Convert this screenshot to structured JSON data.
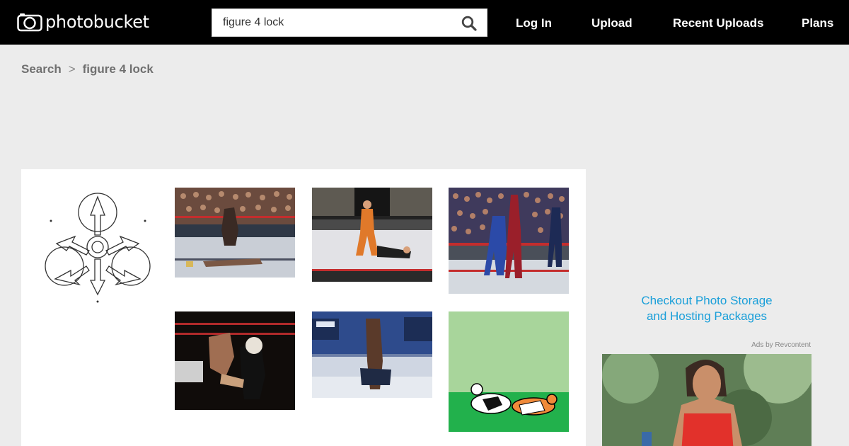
{
  "header": {
    "logo_text": "photobucket",
    "search": {
      "value": "figure 4 lock",
      "placeholder": ""
    },
    "nav": [
      "Log In",
      "Upload",
      "Recent Uploads",
      "Plans"
    ]
  },
  "breadcrumb": {
    "root": "Search",
    "separator": ">",
    "current": "figure 4 lock"
  },
  "sidebar": {
    "promo_line1": "Checkout Photo Storage",
    "promo_line2": "and Hosting Packages",
    "ads_by": "Ads by Revcontent"
  },
  "colors": {
    "header_bg": "#000000",
    "page_bg": "#ececec",
    "link": "#1a9fd9"
  },
  "icons": [
    "camera-logo-icon",
    "search-icon"
  ]
}
